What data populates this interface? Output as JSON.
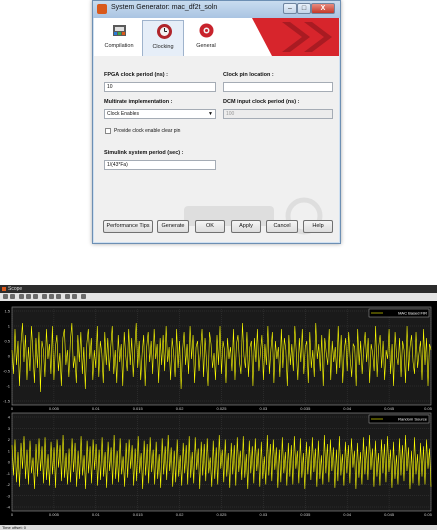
{
  "sysgen": {
    "title": "System Generator: mac_df2t_soln",
    "window_controls": {
      "minimize": "–",
      "maximize": "□",
      "close": "X"
    },
    "tabs": [
      {
        "label": "Compilation",
        "icon": "chip-icon"
      },
      {
        "label": "Clocking",
        "icon": "clock-gear-icon",
        "active": true
      },
      {
        "label": "General",
        "icon": "gear-icon"
      }
    ],
    "fields": {
      "fpga_clock_label": "FPGA clock period (ns) :",
      "fpga_clock_value": "10",
      "clock_pin_label": "Clock pin location :",
      "clock_pin_value": "",
      "multirate_label": "Multirate implementation :",
      "multirate_value": "Clock Enables",
      "dcm_label": "DCM input clock period (ns) :",
      "dcm_value": "100",
      "provide_clear_label": "Provide clock enable clear pin",
      "provide_clear_checked": false,
      "simulink_period_label": "Simulink system period (sec) :",
      "simulink_period_value": "1/(43*Fa)"
    },
    "buttons": {
      "performance_tips": "Performance Tips",
      "generate": "Generate",
      "ok": "OK",
      "apply": "Apply",
      "cancel": "Cancel",
      "help": "Help"
    },
    "colors": {
      "brand": "#d9591b",
      "banner_red": "#d7252c"
    }
  },
  "scope": {
    "title": "Scope",
    "status_text": "Time offset:  0",
    "colors": {
      "background": "#000000",
      "axes": "#1a1a1a",
      "trace": "#ffff00",
      "grid": "#444444"
    }
  },
  "chart_data": [
    {
      "type": "line",
      "legend": "MAC Based FIR",
      "y_ticks": [
        "1.5",
        "1",
        "0.5",
        "0",
        "-0.5",
        "-1",
        "-1.5"
      ],
      "ylim": [
        -1.5,
        1.5
      ],
      "x_ticks": [
        "0",
        "0.005",
        "0.01",
        "0.015",
        "0.02",
        "0.025",
        "0.03",
        "0.035",
        "0.04",
        "0.045",
        "0.05"
      ],
      "xlim": [
        0,
        0.05
      ],
      "grid": true,
      "legend_position": "top-right",
      "series": [
        {
          "name": "MAC Based FIR",
          "color": "#ffff00",
          "values": [
            0.2,
            -0.6,
            0.9,
            -0.3,
            0.5,
            -1.0,
            0.4,
            1.1,
            -0.2,
            0.7,
            -0.8,
            0.3,
            -0.5,
            1.0,
            0.1,
            -0.9,
            0.6,
            -0.4,
            0.8,
            -1.2,
            0.5,
            0.2,
            -0.7,
            0.9,
            -0.1,
            0.4,
            -0.6,
            1.0,
            -0.8,
            0.3,
            0.7,
            -0.5,
            0.1,
            -1.0,
            0.6,
            0.9,
            -0.3,
            0.2,
            -0.7,
            0.5,
            1.1,
            -0.4,
            0.0,
            -0.9,
            0.7,
            -0.2,
            0.8,
            -0.6,
            0.3,
            -1.1,
            0.4,
            0.9,
            -0.1,
            0.6,
            -0.8,
            0.2,
            -0.4,
            1.0,
            -0.7,
            0.5,
            0.1,
            -0.9,
            0.8,
            -0.3,
            0.6,
            -0.5,
            0.3,
            1.0,
            -0.6,
            0.2,
            -0.9,
            0.7,
            -0.2,
            0.4,
            -1.0,
            0.8,
            0.0,
            -0.5,
            0.9,
            -0.3,
            0.6,
            -0.7,
            0.2,
            1.1,
            -0.4,
            0.5,
            -0.8,
            0.1,
            0.7,
            -1.0,
            0.3,
            0.8,
            -0.2,
            0.5,
            -0.6,
            0.9,
            -0.1,
            0.4,
            -0.9,
            0.6,
            -0.3,
            0.7,
            -0.5,
            1.0,
            -0.2,
            0.3,
            -0.8,
            0.6,
            0.1,
            -0.7,
            0.9,
            -0.4,
            0.5,
            -1.1,
            0.2,
            0.8,
            -0.3,
            0.4,
            -0.6,
            1.0,
            -0.1,
            0.7,
            -0.9,
            0.3,
            0.5,
            -0.5,
            0.2,
            0.9,
            -0.7,
            0.6,
            -0.2,
            -1.0,
            0.8,
            0.4,
            -0.4,
            0.1,
            -0.8,
            0.7,
            -0.3,
            1.0,
            -0.6,
            0.5,
            0.2,
            -0.9,
            0.6,
            -0.1,
            0.3,
            -0.5,
            0.9,
            -0.8,
            0.4,
            0.7,
            -0.2,
            -0.6,
            1.1,
            0.0,
            -0.4,
            0.8,
            -0.7,
            0.3,
            0.5,
            -1.0,
            0.6,
            -0.2,
            0.9,
            -0.5,
            0.1,
            0.7,
            -0.8,
            0.4,
            -0.3,
            1.0,
            -0.6,
            0.2,
            0.8,
            -0.9,
            0.5,
            -0.1,
            0.3,
            -0.7,
            0.9,
            -0.4,
            0.6,
            0.2,
            -1.0,
            0.7,
            -0.3,
            0.4,
            -0.5,
            1.0,
            0.1,
            -0.8,
            0.6,
            -0.2,
            0.9,
            -0.6,
            0.3,
            0.5,
            -0.9,
            0.8,
            -0.4,
            0.2,
            -0.7,
            1.1,
            -0.1,
            0.4,
            -0.5,
            0.7,
            -1.0,
            0.6,
            0.1,
            -0.3,
            0.9,
            -0.8,
            0.5,
            -0.2,
            0.3,
            -0.6,
            1.0,
            -0.4,
            0.7,
            -0.9,
            0.2,
            0.6,
            -0.5,
            0.8,
            -0.1,
            -0.7,
            0.4,
            0.3,
            -1.0,
            0.9,
            -0.3,
            0.5,
            -0.6,
            0.2,
            0.8,
            -0.2,
            0.6,
            -0.9,
            0.4,
            0.1,
            -0.5,
            1.0,
            -0.7,
            0.3,
            0.7,
            -0.4,
            0.5,
            -0.8,
            0.2,
            -0.1,
            0.9,
            -0.6,
            0.4,
            -1.0,
            0.8,
            0.0,
            -0.3,
            0.6,
            -0.7,
            0.5,
            0.2,
            -0.9,
            1.0,
            -0.5,
            0.3,
            0.7,
            -0.2,
            -0.6,
            0.8,
            -0.4,
            0.1,
            0.5,
            -0.8,
            0.9,
            -0.3,
            0.6,
            -1.0,
            0.4,
            0.2
          ]
        }
      ]
    },
    {
      "type": "line",
      "legend": "Random Source",
      "y_ticks": [
        "4",
        "3",
        "2",
        "1",
        "0",
        "-1",
        "-2",
        "-3",
        "-4"
      ],
      "ylim": [
        -4,
        4
      ],
      "x_ticks": [
        "0",
        "0.005",
        "0.01",
        "0.015",
        "0.02",
        "0.025",
        "0.03",
        "0.035",
        "0.04",
        "0.045",
        "0.05"
      ],
      "xlim": [
        0,
        0.05
      ],
      "grid": true,
      "legend_position": "top-right",
      "series": [
        {
          "name": "Random Source",
          "color": "#ffff00",
          "values": [
            1.5,
            -1.2,
            2.0,
            -1.8,
            0.9,
            -2.2,
            1.7,
            -0.6,
            2.3,
            -1.5,
            1.1,
            -2.0,
            1.9,
            -1.0,
            0.4,
            -2.4,
            1.6,
            -1.3,
            2.1,
            -0.8,
            1.4,
            -1.9,
            2.2,
            -1.6,
            0.7,
            -2.1,
            1.8,
            -1.1,
            1.3,
            -2.3,
            2.0,
            -0.5,
            1.5,
            -1.7,
            2.4,
            -1.4,
            0.8,
            -2.0,
            1.2,
            -1.8,
            2.1,
            -0.9,
            1.7,
            -2.2,
            1.0,
            -1.5,
            2.3,
            -1.2,
            0.6,
            -2.4,
            1.9,
            -1.0,
            1.4,
            -1.9,
            2.0,
            -0.7,
            1.6,
            -2.1,
            1.1,
            -1.6,
            2.2,
            -1.3,
            0.9,
            -2.3,
            1.8,
            -0.8,
            1.3,
            -2.0,
            2.4,
            -1.5,
            1.0,
            -1.8,
            2.1,
            -1.1,
            0.5,
            -2.2,
            1.7,
            -1.4,
            2.0,
            -0.6,
            1.5,
            -2.1,
            1.2,
            -1.7,
            2.3,
            -1.0,
            0.8,
            -2.4,
            1.9,
            -1.2,
            1.6,
            -1.9,
            2.2,
            -0.9,
            1.1,
            -2.0,
            1.8,
            -1.5,
            0.7,
            -2.3,
            2.1,
            -1.1,
            1.4,
            -1.6,
            2.4,
            -0.8,
            1.3,
            -2.2,
            1.0,
            -1.8,
            2.0,
            -1.3,
            0.6,
            -2.1,
            1.7,
            -1.0,
            1.5,
            -2.0,
            2.3,
            -1.4,
            0.9,
            -1.9,
            2.2,
            -0.7,
            1.2,
            -2.4,
            1.8,
            -1.2,
            1.6,
            -1.7,
            2.1,
            -1.0,
            0.4,
            -2.2,
            1.9,
            -1.5,
            1.3,
            -2.0,
            2.4,
            -0.6,
            1.1,
            -1.8,
            2.0,
            -1.3,
            0.8,
            -2.3,
            1.7,
            -1.1,
            1.5,
            -2.1,
            2.2,
            -0.9,
            1.0,
            -1.6,
            2.3,
            -1.4,
            0.7,
            -2.4,
            1.9,
            -1.0,
            1.4,
            -1.9,
            2.1,
            -0.8,
            1.2,
            -2.2,
            1.8,
            -1.5,
            0.5,
            -2.0,
            2.4,
            -1.2,
            1.6,
            -1.7,
            2.0,
            -0.7,
            1.3,
            -2.3,
            1.1,
            -1.8,
            2.2,
            -1.0,
            0.9,
            -2.1,
            1.7,
            -1.3,
            1.5,
            -2.0,
            2.3,
            -0.6,
            1.0,
            -1.9,
            2.1,
            -1.4,
            0.8,
            -2.4,
            1.8,
            -1.1,
            1.4,
            -1.6,
            2.2,
            -0.9,
            1.2,
            -2.2,
            1.9,
            -1.5,
            0.6,
            -2.0,
            2.4,
            -1.0,
            1.6,
            -1.8,
            2.0,
            -0.8,
            1.3,
            -2.3,
            1.1,
            -1.7,
            2.3,
            -1.2,
            0.7,
            -2.1,
            1.8,
            -1.0,
            1.5,
            -1.9,
            2.1,
            -0.5,
            1.0,
            -2.4,
            1.7,
            -1.4,
            0.9,
            -2.0,
            2.2,
            -1.1,
            1.4,
            -1.6,
            2.4,
            -0.7,
            1.2,
            -2.2,
            1.9,
            -1.3,
            0.8,
            -2.1,
            2.0,
            -1.0,
            1.6,
            -1.8,
            2.3,
            -0.9,
            1.1,
            -2.3,
            1.8,
            -1.5,
            0.6,
            -2.0,
            2.1,
            -1.2,
            1.5,
            -1.7,
            2.4,
            -0.8,
            1.3,
            -2.4,
            1.0,
            -1.9,
            2.2,
            -1.1,
            0.7,
            -2.1,
            1.7,
            -1.3,
            1.4,
            -2.0,
            2.0,
            -0.6,
            1.2,
            -2.2
          ]
        }
      ]
    }
  ]
}
